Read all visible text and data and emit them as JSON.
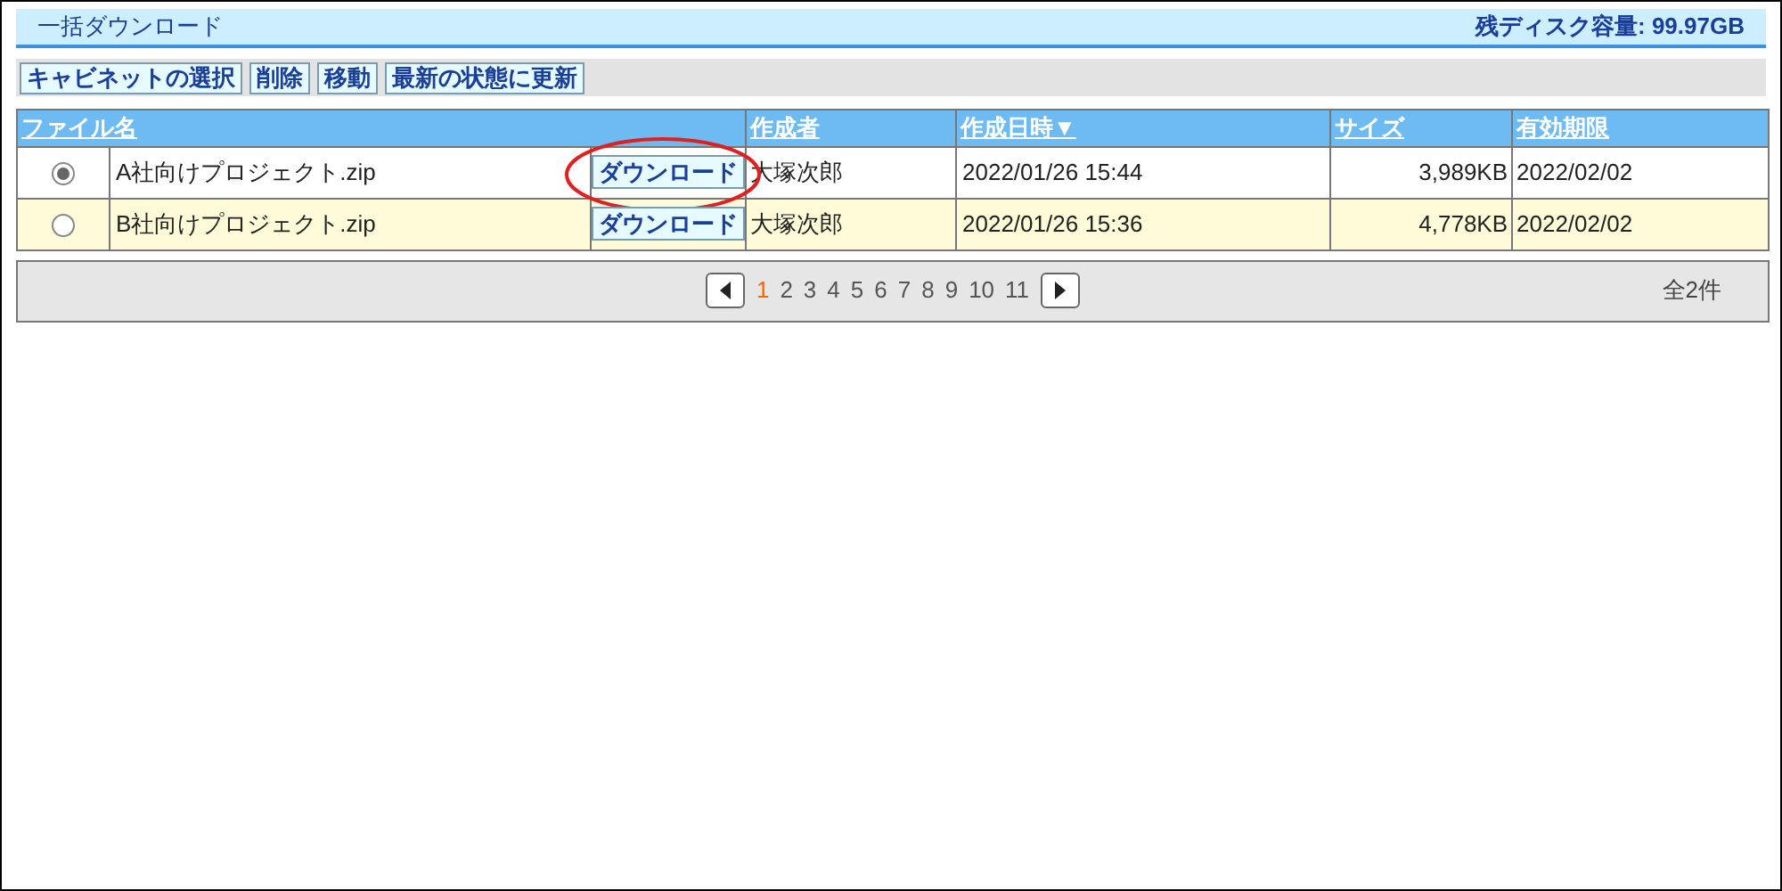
{
  "header": {
    "title": "一括ダウンロード",
    "disk_space": "残ディスク容量: 99.97GB"
  },
  "toolbar": [
    "キャビネットの選択",
    "削除",
    "移動",
    "最新の状態に更新"
  ],
  "table": {
    "columns": [
      "ファイル名",
      "作成者",
      "作成日時▼",
      "サイズ",
      "有効期限"
    ],
    "rows": [
      {
        "selected": true,
        "file": "A社向けプロジェクト.zip",
        "button": "ダウンロード",
        "highlighted": true,
        "author": "大塚次郎",
        "created": "2022/01/26 15:44",
        "size": "3,989KB",
        "expires": "2022/02/02"
      },
      {
        "selected": false,
        "file": "B社向けプロジェクト.zip",
        "button": "ダウンロード",
        "highlighted": false,
        "author": "大塚次郎",
        "created": "2022/01/26 15:36",
        "size": "4,778KB",
        "expires": "2022/02/02"
      }
    ]
  },
  "pagination": {
    "pages": [
      {
        "label": "1",
        "selected": true
      },
      {
        "label": "2",
        "selected": false
      },
      {
        "label": "3",
        "selected": false
      },
      {
        "label": "4",
        "selected": false
      },
      {
        "label": "5",
        "selected": false
      },
      {
        "label": "6",
        "selected": false
      },
      {
        "label": "7",
        "selected": false
      },
      {
        "label": "8",
        "selected": false
      },
      {
        "label": "9",
        "selected": false
      },
      {
        "label": "10",
        "selected": false
      },
      {
        "label": "11",
        "selected": false
      }
    ],
    "total": "全2件"
  }
}
